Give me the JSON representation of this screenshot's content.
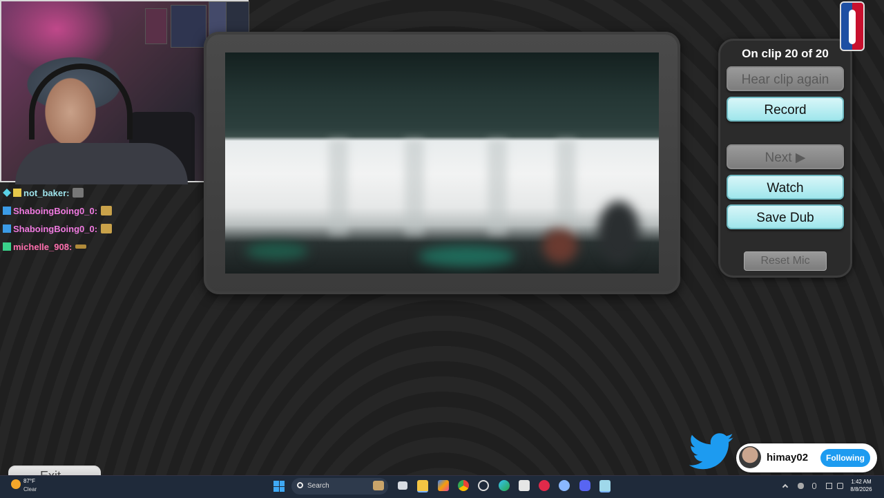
{
  "panel": {
    "title": "On clip 20 of 20",
    "hear_clip_label": "Hear clip again",
    "record_label": "Record",
    "next_label": "Next ▶",
    "watch_label": "Watch",
    "save_dub_label": "Save Dub",
    "reset_mic_label": "Reset Mic"
  },
  "chat": {
    "messages": [
      {
        "user": "not_baker:",
        "color": "#9fe4ec"
      },
      {
        "user": "ShaboingBoing0_0:",
        "color": "#f07ae0"
      },
      {
        "user": "ShaboingBoing0_0:",
        "color": "#f07ae0"
      },
      {
        "user": "michelle_908:",
        "color": "#ff6fae"
      }
    ]
  },
  "twitter": {
    "handle": "himay02",
    "follow_label": "Following"
  },
  "exit_label": "Exit",
  "taskbar": {
    "weather_temp": "87°F",
    "weather_desc": "Clear",
    "search_label": "Search",
    "time": "1:42 AM",
    "date": "8/8/2026"
  },
  "colors": {
    "button_accent": "#a8e8ee",
    "disabled_button": "#8c8c8c",
    "twitter_blue": "#1d9bf0"
  },
  "icons": [
    "windows-start-icon",
    "search-icon",
    "twitter-bird-icon",
    "network-icon",
    "volume-icon",
    "battery-icon"
  ]
}
